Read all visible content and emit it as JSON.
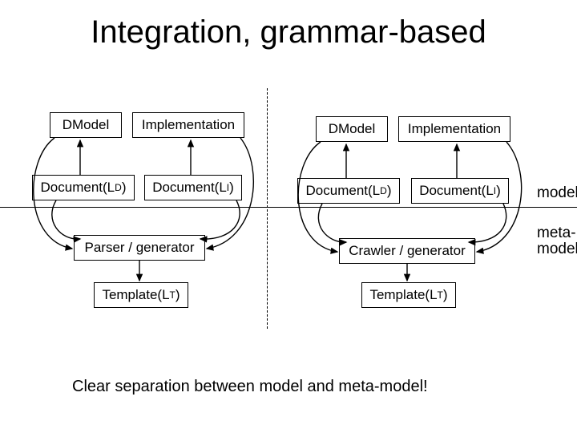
{
  "title": "Integration, grammar-based",
  "left": {
    "dmodel": "DModel",
    "impl": "Implementation",
    "docD_pre": "Document(L",
    "docD_sub": "D",
    "docD_post": ")",
    "docI_pre": "Document(L",
    "docI_sub": "I",
    "docI_post": ")",
    "parser": "Parser / generator",
    "tmpl_pre": "Template(L",
    "tmpl_sub": "T",
    "tmpl_post": ")"
  },
  "right": {
    "dmodel": "DModel",
    "impl": "Implementation",
    "docD_pre": "Document(L",
    "docD_sub": "D",
    "docD_post": ")",
    "docI_pre": "Document(L",
    "docI_sub": "I",
    "docI_post": ")",
    "crawler": "Crawler / generator",
    "tmpl_pre": "Template(L",
    "tmpl_sub": "T",
    "tmpl_post": ")"
  },
  "labels": {
    "model": "model",
    "metamodel1": "meta-",
    "metamodel2": "model"
  },
  "footer": "Clear separation between model and meta-model!"
}
